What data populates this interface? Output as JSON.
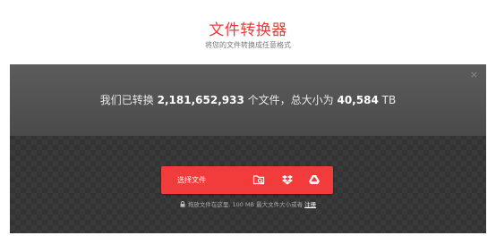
{
  "header": {
    "title": "文件转换器",
    "subtitle": "将您的文件转换成任意格式"
  },
  "banner": {
    "close_symbol": "×",
    "stats_prefix": "我们已转换",
    "files_count": "2,181,652,933",
    "stats_middle": "个文件，总大小为",
    "total_size": "40,584",
    "size_unit": "TB"
  },
  "upload": {
    "choose_label": "选择文件",
    "icons": [
      "folder-search-icon",
      "dropbox-icon",
      "google-drive-icon"
    ]
  },
  "hint": {
    "text": "拖放文件在这里. 100 MB 最大文件大小或者",
    "link": "注册"
  },
  "colors": {
    "accent": "#f23b3b",
    "title": "#ee3a3a",
    "panel": "#3a3a3a"
  }
}
